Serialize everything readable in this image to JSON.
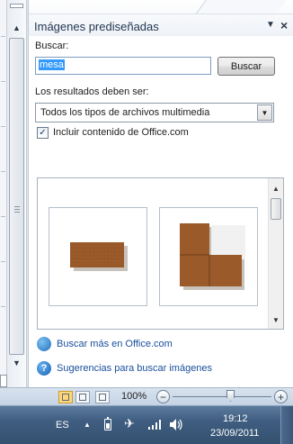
{
  "task_pane": {
    "title": "Imágenes prediseñadas",
    "menu_icon": "dropdown-triangle-icon",
    "close_label": "×",
    "search_label": "Buscar:",
    "search_value": "mesa",
    "search_button": "Buscar",
    "results_label": "Los resultados deben ser:",
    "results_select_value": "Todos los tipos de archivos multimedia",
    "include_office_checked": true,
    "include_office_label": "Incluir contenido de Office.com",
    "results": [
      {
        "name": "table-clipart-1",
        "color": "#9b5a2a"
      },
      {
        "name": "table-clipart-2",
        "color": "#9b5a2a"
      }
    ],
    "links": [
      {
        "icon": "office-online-icon",
        "label": "Buscar más en Office.com"
      },
      {
        "icon": "help-icon",
        "label": "Sugerencias para buscar imágenes"
      }
    ]
  },
  "statusbar": {
    "zoom_label": "100%",
    "zoom_out_label": "−",
    "zoom_in_label": "+",
    "zoom_level_fraction": 0.55,
    "views": [
      "print-layout-icon",
      "full-screen-reading-icon",
      "web-layout-icon"
    ]
  },
  "taskbar": {
    "language": "ES",
    "tray_up_label": "▲",
    "time": "19:12",
    "date": "23/09/2011"
  },
  "colors": {
    "accent_link": "#1a4f9c",
    "selection": "#3399ff",
    "clipart_brown": "#9b5a2a",
    "taskbar": "#3f5d80"
  }
}
